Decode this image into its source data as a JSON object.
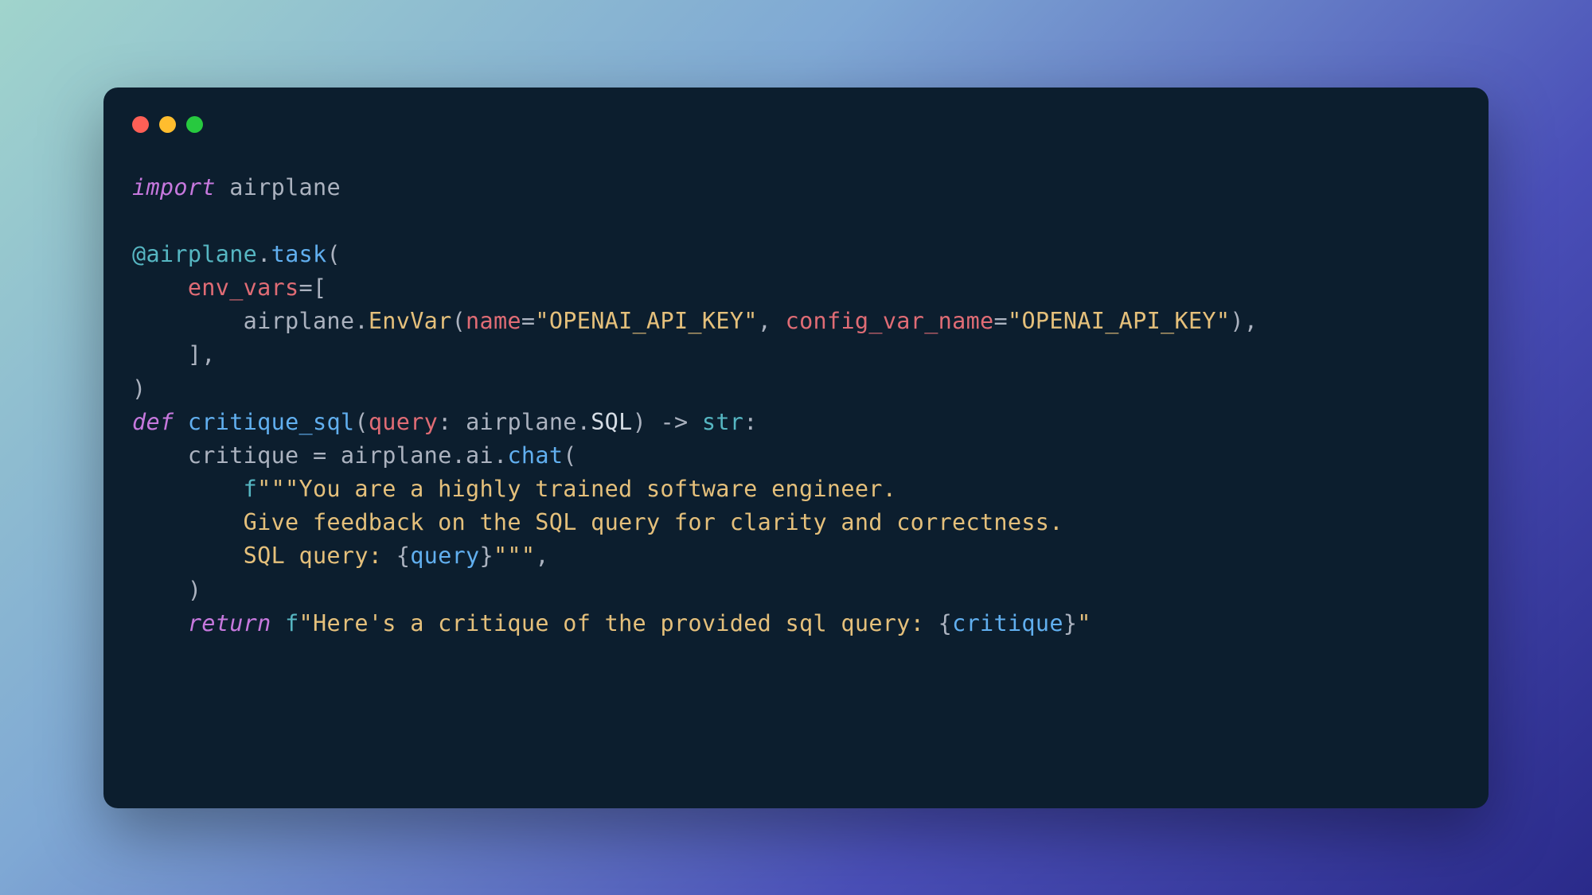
{
  "colors": {
    "windowBg": "#0c1e2e",
    "red": "#ff5f56",
    "yellow": "#ffbd2e",
    "green": "#27c93f"
  },
  "traffic": {
    "red": "close-button",
    "yellow": "minimize-button",
    "green": "maximize-button"
  },
  "code": {
    "l1": {
      "kw": "import",
      "sp": " ",
      "mod": "airplane"
    },
    "l2": "",
    "l3": {
      "at": "@airplane",
      "dot": ".",
      "fn": "task",
      "open": "("
    },
    "l4": {
      "indent": "    ",
      "param": "env_vars",
      "eq": "=["
    },
    "l5": {
      "indent": "        ",
      "mod": "airplane",
      "dot1": ".",
      "cls": "EnvVar",
      "open": "(",
      "p1": "name",
      "eq1": "=",
      "s1": "\"OPENAI_API_KEY\"",
      "comma": ", ",
      "p2": "config_var_name",
      "eq2": "=",
      "s2": "\"OPENAI_API_KEY\"",
      "close": "),"
    },
    "l6": {
      "indent": "    ",
      "close": "],"
    },
    "l7": {
      "close": ")"
    },
    "l8": {
      "kw": "def",
      "sp": " ",
      "fn": "critique_sql",
      "open": "(",
      "param": "query",
      "colon": ": ",
      "mod": "airplane",
      "dot": ".",
      "cls": "SQL",
      "close": ") -> ",
      "ret": "str",
      "end": ":"
    },
    "l9": {
      "indent": "    ",
      "var": "critique",
      "eq": " = ",
      "mod": "airplane",
      "dot1": ".",
      "attr": "ai",
      "dot2": ".",
      "fn": "chat",
      "open": "("
    },
    "l10": {
      "indent": "        ",
      "fpre": "f",
      "str": "\"\"\"You are a highly trained software engineer."
    },
    "l11": {
      "indent": "        ",
      "str": "Give feedback on the SQL query for clarity and correctness."
    },
    "l12": {
      "indent": "        ",
      "str1": "SQL query: ",
      "br1": "{",
      "var": "query",
      "br2": "}",
      "str2": "\"\"\"",
      "comma": ","
    },
    "l13": {
      "indent": "    ",
      "close": ")"
    },
    "l14": {
      "indent": "    ",
      "kw": "return",
      "sp": " ",
      "fpre": "f",
      "str1": "\"Here's a critique of the provided sql query: ",
      "br1": "{",
      "var": "critique",
      "br2": "}",
      "str2": "\""
    }
  }
}
